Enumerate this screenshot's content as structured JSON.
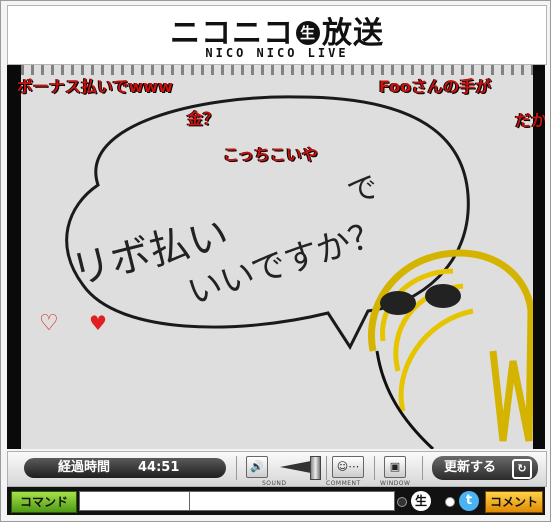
{
  "header": {
    "logo_main_left": "ニコニコ",
    "logo_badge": "生",
    "logo_main_right": "放送",
    "logo_sub": "NICO NICO LIVE"
  },
  "video": {
    "sketch_line_1": "リボ払い",
    "sketch_line_2": "いいですか？",
    "sketch_overlap": "で",
    "comments": [
      {
        "text": "ボーナス払いでwww"
      },
      {
        "text": "Fooさんの手が"
      },
      {
        "text": "金？"
      },
      {
        "text": "だか"
      },
      {
        "text": "こっちこいや"
      }
    ],
    "heart_outline": "♡",
    "heart_solid": "♥"
  },
  "controls": {
    "elapsed_label": "経過時間",
    "elapsed_value": "44:51",
    "sound_caption": "SOUND",
    "comment_caption": "COMMENT",
    "window_caption": "WINDOW",
    "refresh_label": "更新する",
    "sound_glyph": "🔊",
    "comment_glyph": "☺⋯",
    "window_glyph": "▣"
  },
  "bottom": {
    "command_label": "コマンド",
    "command_value": "",
    "comment_value": "",
    "nama_label": "生",
    "twitter_label": "t",
    "comment_button": "コメント"
  },
  "colors": {
    "comment_red": "#c8120e",
    "command_green": "#4f9a14",
    "comment_orange": "#e08a00",
    "twitter_blue": "#4ab3f4"
  }
}
